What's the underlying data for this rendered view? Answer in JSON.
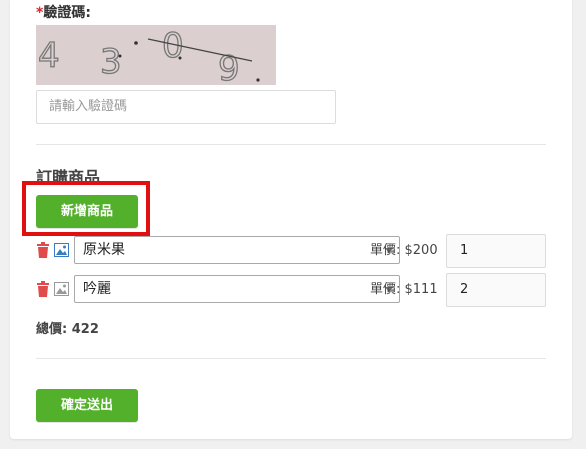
{
  "captcha": {
    "label": "驗證碼:",
    "required_mark": "*",
    "image_text": "4 3 0 9",
    "placeholder": "請輸入驗證碼"
  },
  "order": {
    "section_title": "訂購商品",
    "add_button": "新增商品",
    "items": [
      {
        "product": "原米果",
        "price_label": "單價: $200",
        "quantity": "1"
      },
      {
        "product": "吟麗",
        "price_label": "單價: $111",
        "quantity": "2"
      }
    ],
    "total_label": "總價: 422"
  },
  "submit_button": "確定送出",
  "colors": {
    "accent_green": "#52b02a",
    "highlight_red": "#e01010",
    "required_red": "#d9232d",
    "trash_red": "#e04b4b",
    "image_blue": "#3a7cc0"
  },
  "icons": {
    "trash": "trash-icon",
    "image": "image-icon",
    "dropdown": "chevron-down-icon"
  }
}
